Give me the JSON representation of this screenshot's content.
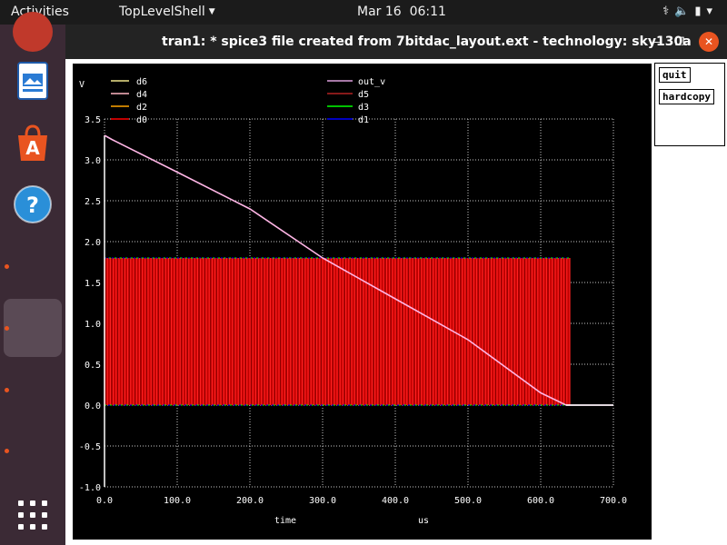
{
  "topbar": {
    "activities": "Activities",
    "app_name": "TopLevelShell",
    "clock_date": "Mar 16",
    "clock_time": "06:11",
    "tray_icons": [
      "network-icon",
      "volume-icon",
      "battery-icon",
      "system-menu-icon"
    ]
  },
  "dock": {
    "apps": [
      "app-icon-partial",
      "libreoffice-impress-icon",
      "ubuntu-software-icon",
      "help-icon",
      "show-applications-icon"
    ]
  },
  "window": {
    "title": "tran1: * spice3 file created from 7bitdac_layout.ext - technology: sky130a",
    "buttons": [
      "minimize",
      "maximize",
      "close"
    ]
  },
  "panel": {
    "quit_label": "quit",
    "hardcopy_label": "hardcopy"
  },
  "chart_data": {
    "type": "line",
    "ylabel": "V",
    "xlabel": "time",
    "xunit": "us",
    "xlim": [
      0,
      700
    ],
    "ylim": [
      -1.0,
      3.5
    ],
    "x_ticks": [
      "0.0",
      "100.0",
      "200.0",
      "300.0",
      "400.0",
      "500.0",
      "600.0",
      "700.0"
    ],
    "y_ticks": [
      "3.5",
      "3.0",
      "2.5",
      "2.0",
      "1.5",
      "1.0",
      "0.5",
      "0.0",
      "-0.5",
      "-1.0"
    ],
    "grid": true,
    "legend_left": [
      {
        "name": "d6",
        "color": "#f0e68c"
      },
      {
        "name": "d4",
        "color": "#ffb6c1"
      },
      {
        "name": "d2",
        "color": "#ffa500"
      },
      {
        "name": "d0",
        "color": "#ff0000"
      }
    ],
    "legend_right": [
      {
        "name": "out_v",
        "color": "#dda0dd"
      },
      {
        "name": "d5",
        "color": "#b22222"
      },
      {
        "name": "d3",
        "color": "#00ff00"
      },
      {
        "name": "d1",
        "color": "#0000ff"
      }
    ],
    "digital_high": 1.8,
    "digital_low": 0.0,
    "digital_end": 640,
    "out_v": {
      "x": [
        0,
        10,
        100,
        200,
        300,
        400,
        500,
        600,
        635,
        700
      ],
      "y": [
        3.3,
        3.25,
        2.85,
        2.4,
        1.8,
        1.3,
        0.8,
        0.15,
        0.0,
        0.0
      ]
    }
  }
}
